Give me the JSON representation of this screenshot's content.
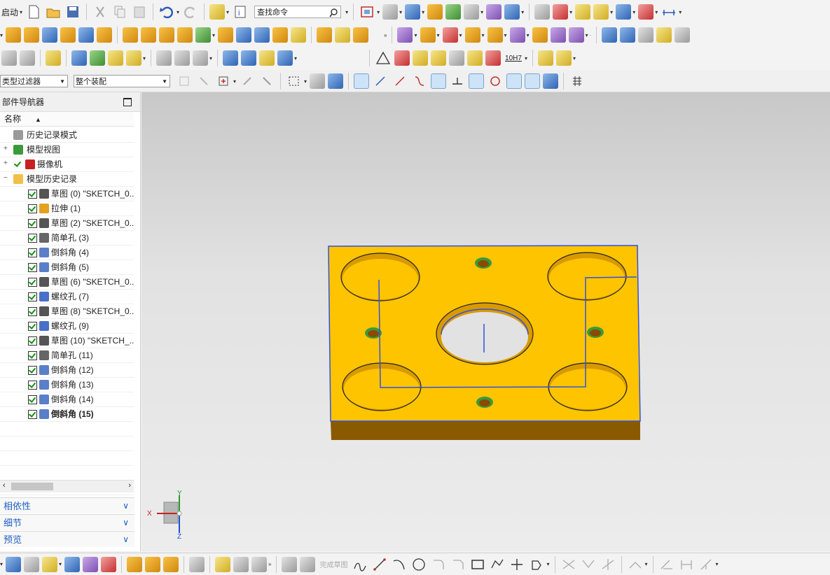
{
  "toolbar": {
    "start_label": "启动",
    "search_placeholder": "查找命令",
    "sketch_finish_label": "完成草图",
    "fit_label": "10H7"
  },
  "selection_bar": {
    "filter_value": "类型过滤器",
    "scope_value": "整个装配"
  },
  "navigator": {
    "title": "部件导航器",
    "column_name": "名称",
    "items": [
      {
        "label": "历史记录模式",
        "icon": "clock-icon"
      },
      {
        "label": "模型视图",
        "icon": "model-views-icon"
      },
      {
        "label": "摄像机",
        "icon": "camera-icon"
      },
      {
        "label": "模型历史记录",
        "icon": "folder-icon"
      },
      {
        "label": "草图 (0) \"SKETCH_0...",
        "icon": "sketch-icon"
      },
      {
        "label": "拉伸 (1)",
        "icon": "extrude-icon"
      },
      {
        "label": "草图 (2) \"SKETCH_0...",
        "icon": "sketch-icon"
      },
      {
        "label": "简单孔 (3)",
        "icon": "simple-hole-icon"
      },
      {
        "label": "倒斜角 (4)",
        "icon": "chamfer-icon"
      },
      {
        "label": "倒斜角 (5)",
        "icon": "chamfer-icon"
      },
      {
        "label": "草图 (6) \"SKETCH_0...",
        "icon": "sketch-icon"
      },
      {
        "label": "螺纹孔 (7)",
        "icon": "threaded-hole-icon"
      },
      {
        "label": "草图 (8) \"SKETCH_0...",
        "icon": "sketch-icon"
      },
      {
        "label": "螺纹孔 (9)",
        "icon": "threaded-hole-icon"
      },
      {
        "label": "草图 (10) \"SKETCH_...",
        "icon": "sketch-icon"
      },
      {
        "label": "简单孔 (11)",
        "icon": "simple-hole-icon"
      },
      {
        "label": "倒斜角 (12)",
        "icon": "chamfer-icon"
      },
      {
        "label": "倒斜角 (13)",
        "icon": "chamfer-icon"
      },
      {
        "label": "倒斜角 (14)",
        "icon": "chamfer-icon"
      },
      {
        "label": "倒斜角 (15)",
        "icon": "chamfer-icon"
      }
    ]
  },
  "panels": {
    "dependencies": "相依性",
    "details": "细节",
    "preview": "预览"
  },
  "triad": {
    "x_label": "X",
    "y_label": "Y",
    "z_label": "Z"
  },
  "colors": {
    "part_face": "#ffc400",
    "part_side": "#8a5a00",
    "sketch_line": "#3050e0",
    "hole_edge": "#3a9a3a",
    "panel_text": "#1f5fbf"
  }
}
